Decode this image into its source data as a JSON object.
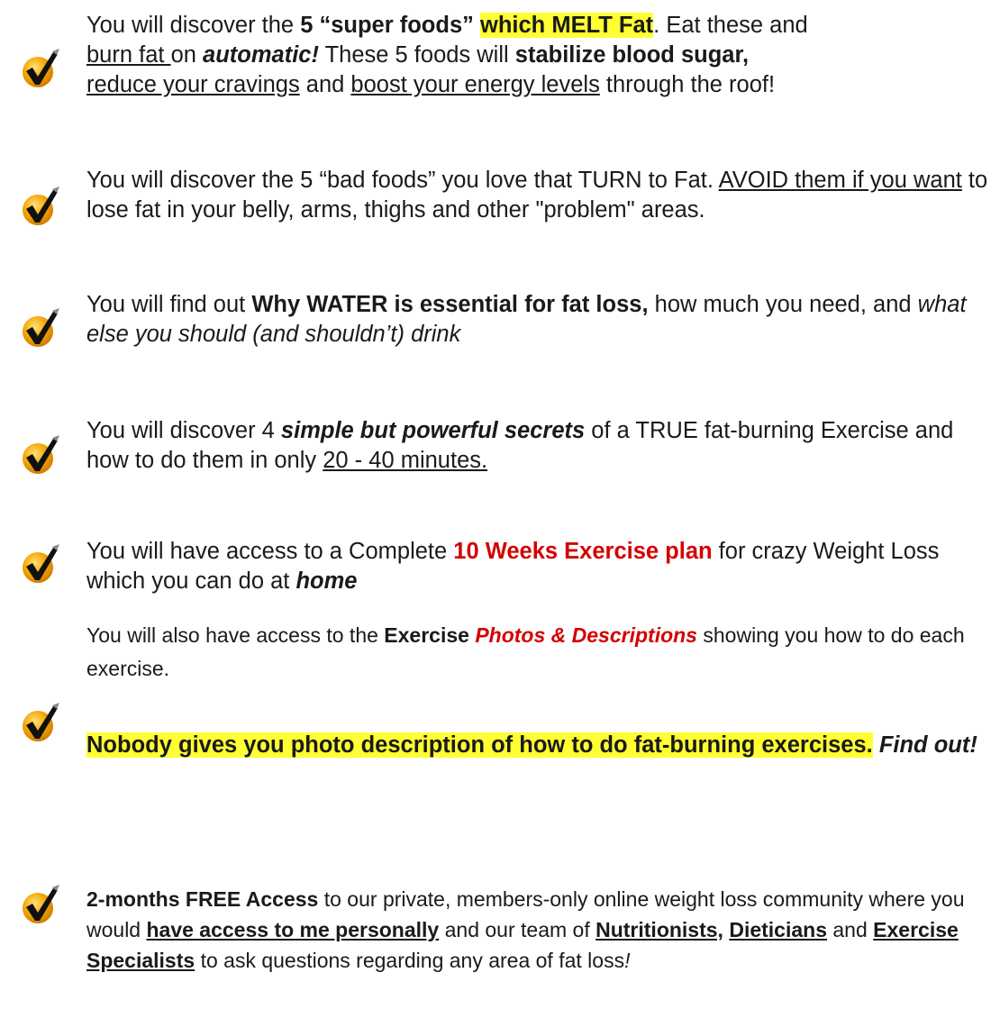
{
  "icon": "check-mark-icon",
  "colors": {
    "highlight": "#ffff33",
    "accent_red": "#d40000",
    "check_orange": "#f5a300",
    "check_black": "#111111"
  },
  "items": [
    {
      "a": "You will discover the ",
      "b": "5 “super foods”",
      "c": " ",
      "d": "which MELT Fat",
      "e": ". Eat these and ",
      "f": "burn fat ",
      "g": "on ",
      "h": "automatic!",
      "i": " These 5 foods will ",
      "j": "stabilize blood sugar,",
      "k": "reduce your cravings",
      "l": " and ",
      "m": "boost your energy levels",
      "n": " through the roof!"
    },
    {
      "a": "You will discover the 5 “bad foods” you love that TURN to Fat. ",
      "b": "AVOID them if you want",
      "c": " to lose fat in your belly, arms, thighs and other \"problem\" areas."
    },
    {
      "a": "You will find out ",
      "b": "Why WATER is essential for fat loss,",
      "c": " how much you need, and ",
      "d": "what else you should (and shouldn’t) drink"
    },
    {
      "a": "You will discover 4 ",
      "b": "simple but powerful secrets",
      "c": " of a TRUE fat-burning Exercise and how to do them in only ",
      "d": "20 - 40 minutes."
    },
    {
      "a": "You will have access to a Complete ",
      "b": "10 Weeks Exercise plan",
      "c": " for crazy Weight Loss which you can do at ",
      "d": "home"
    },
    {
      "a": "You will also have access to the ",
      "b": "Exercise",
      "c": " ",
      "d": "Photos & Descriptions",
      "e": " showing you how to do each exercise."
    },
    {
      "a": "Nobody gives you photo description of how to do fat-burning exercises.",
      "b": " ",
      "c": "Find out!"
    },
    {
      "a": "2-months FREE Access",
      "b": " to our private, members-only online weight loss community where you would ",
      "c": "have access to me personally",
      "d": " and our team of ",
      "e": "Nutritionists,",
      "f": " ",
      "g": "Dieticians",
      "h": " and ",
      "i": "Exercise Specialists",
      "j": " to ask questions regarding any area of fat loss",
      "k": "!"
    }
  ]
}
